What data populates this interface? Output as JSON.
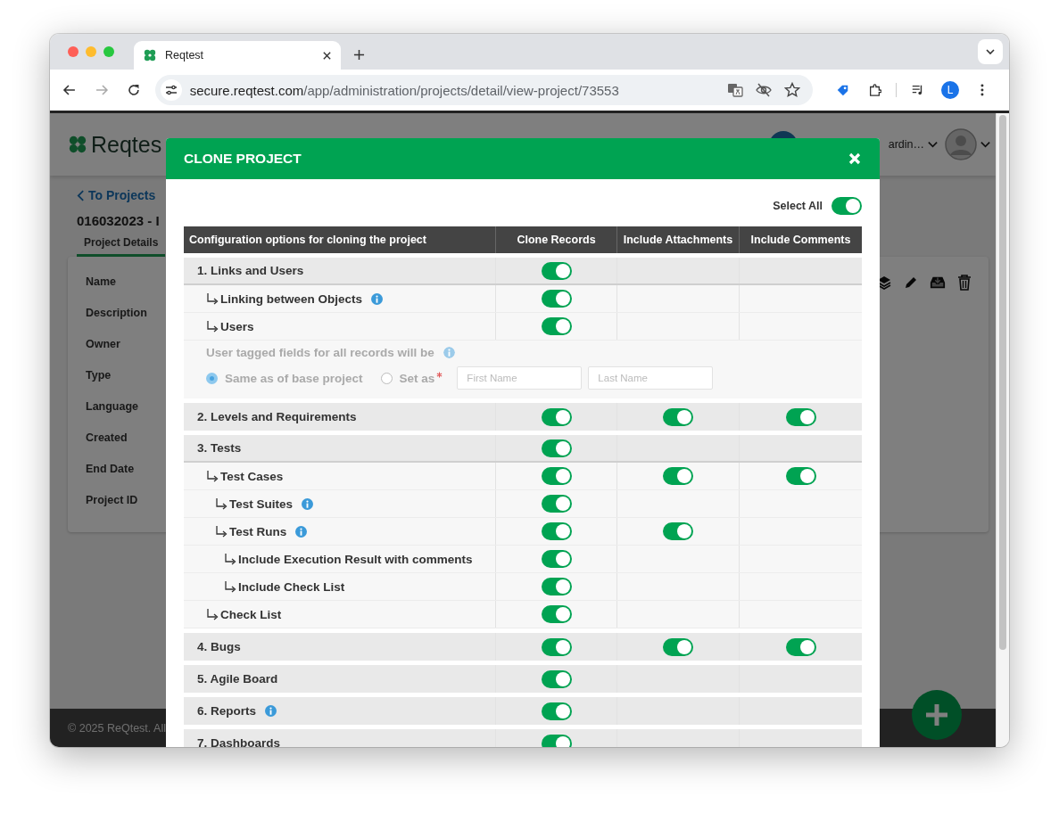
{
  "browser": {
    "tabs": [
      {
        "title": "Reqtest",
        "selected": true
      }
    ],
    "url": {
      "host": "secure.reqtest.com",
      "path": "/app/administration/projects/detail/view-project/73553"
    },
    "profile_initial": "L"
  },
  "app": {
    "logo": "Reqtes",
    "user_name": "ardin…",
    "back_link": "To Projects",
    "project_title": "016032023 - I",
    "tabs": [
      {
        "label": "Project Details",
        "selected": true
      }
    ],
    "fields": [
      "Name",
      "Description",
      "Owner",
      "Type",
      "Language",
      "Created",
      "End Date",
      "Project ID"
    ],
    "footer": "© 2025 ReQtest. All"
  },
  "dialog": {
    "title": "CLONE PROJECT",
    "select_all": {
      "label": "Select All",
      "on": true
    },
    "table": {
      "columns": [
        "Configuration options for cloning the project",
        "Clone Records",
        "Include Attachments",
        "Include Comments"
      ],
      "groups": [
        {
          "label": "1. Links and Users",
          "info": false,
          "clone_records": true,
          "children": [
            {
              "label": "Linking between Objects",
              "info": true,
              "clone_records": true
            },
            {
              "label": "Users",
              "info": false,
              "clone_records": true
            }
          ],
          "user_fields": {
            "label": "User tagged fields for all records will be",
            "info": true,
            "disabled": true,
            "options": [
              {
                "label": "Same as of base project",
                "selected": true,
                "required": false
              },
              {
                "label": "Set as",
                "selected": false,
                "required": true
              }
            ],
            "first_name": {
              "placeholder": "First Name"
            },
            "last_name": {
              "placeholder": "Last Name"
            }
          }
        },
        {
          "label": "2. Levels and Requirements",
          "info": false,
          "clone_records": true,
          "include_attachments": true,
          "include_comments": true
        },
        {
          "label": "3. Tests",
          "info": false,
          "clone_records": true,
          "children": [
            {
              "label": "Test Cases",
              "info": false,
              "clone_records": true,
              "include_attachments": true,
              "include_comments": true,
              "children": [
                {
                  "label": "Test Suites",
                  "info": true,
                  "clone_records": true
                },
                {
                  "label": "Test Runs",
                  "info": true,
                  "clone_records": true,
                  "include_attachments": true,
                  "children": [
                    {
                      "label": "Include Execution Result with comments",
                      "info": false,
                      "clone_records": true
                    },
                    {
                      "label": "Include Check List",
                      "info": false,
                      "clone_records": true
                    }
                  ]
                }
              ]
            },
            {
              "label": "Check List",
              "info": false,
              "clone_records": true
            }
          ]
        },
        {
          "label": "4. Bugs",
          "info": false,
          "clone_records": true,
          "include_attachments": true,
          "include_comments": true
        },
        {
          "label": "5. Agile Board",
          "info": false,
          "clone_records": true
        },
        {
          "label": "6. Reports",
          "info": true,
          "clone_records": true
        },
        {
          "label": "7. Dashboards",
          "info": false,
          "clone_records": true
        }
      ]
    }
  }
}
